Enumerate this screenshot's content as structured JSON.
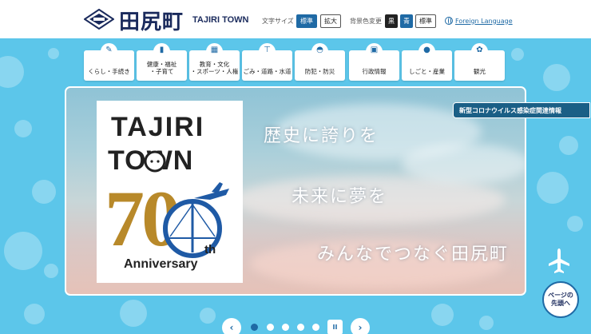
{
  "header": {
    "logo_jp": "田尻町",
    "logo_en": "TAJIRI TOWN",
    "font_size_label": "文字サイズ",
    "font_size_buttons": [
      "標準",
      "拡大"
    ],
    "color_label": "背景色変更",
    "color_buttons": [
      "黒",
      "青",
      "標準"
    ],
    "foreign_language": "Foreign Language"
  },
  "nav": [
    {
      "label": "くらし・手続き",
      "icon": "pencil-icon"
    },
    {
      "label": "健康・福祉\n・子育て",
      "icon": "bottle-icon"
    },
    {
      "label": "教育・文化\n・スポーツ・人権",
      "icon": "school-icon"
    },
    {
      "label": "ごみ・道路・水道",
      "icon": "faucet-icon"
    },
    {
      "label": "防犯・防災",
      "icon": "helmet-icon"
    },
    {
      "label": "行政情報",
      "icon": "briefcase-icon"
    },
    {
      "label": "しごと・産業",
      "icon": "apple-icon"
    },
    {
      "label": "観光",
      "icon": "flower-icon"
    }
  ],
  "hero": {
    "logo_tajiri": "TAJIRI",
    "logo_town": "TOWN",
    "logo_number": "70",
    "logo_th": "th",
    "logo_anniversary": "Anniversary",
    "slogan_1": "歴史に誇りを",
    "slogan_2": "未来に夢を",
    "slogan_3": "みんなでつなぐ田尻町",
    "notice": "新型コロナウイルス感染症関連情報"
  },
  "slider": {
    "prev": "‹",
    "next": "›",
    "pause": "II",
    "dots": 5,
    "active_dot": 1
  },
  "back_to_top": "ページの\n先頭へ",
  "colors": {
    "background": "#5cc6ea",
    "brand_navy": "#1a2a5c",
    "accent_blue": "#1f6aa5",
    "logo_gold": "#b8892a",
    "notice_bg": "#1a5f86"
  }
}
